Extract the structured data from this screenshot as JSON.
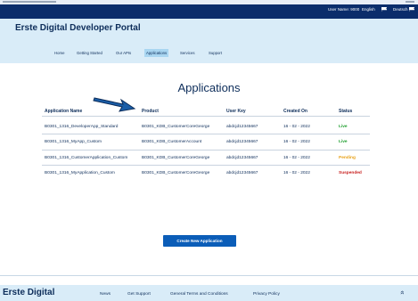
{
  "topbar": {
    "user_label": "User Name: 9000",
    "language_en": "English",
    "language_de": "Deutsch",
    "colors": {
      "background": "#0b2d6b"
    }
  },
  "header": {
    "brand": "Erste Digital Developer Portal",
    "nav": [
      {
        "label": "Home"
      },
      {
        "label": "Getting Started"
      },
      {
        "label": "Our APIs"
      },
      {
        "label": "Applications",
        "active": true
      },
      {
        "label": "Services"
      },
      {
        "label": "Support"
      }
    ]
  },
  "main": {
    "title": "Applications",
    "table": {
      "columns": [
        "Application Name",
        "Product",
        "User Key",
        "Created On",
        "Status"
      ],
      "rows": [
        [
          "B0301_1316_DeveloperApp_Standard",
          "B0301_KDB_CustomerCoreGeorge",
          "abdcjd12345667",
          "16 - 02 - 2022",
          "Live"
        ],
        [
          "B0301_1316_MyApp_Custom",
          "B0301_KDB_CustomerAccount",
          "abdcjd12345667",
          "16 - 02 - 2022",
          "Live"
        ],
        [
          "B0301_1316_CustomerApplication_Custom",
          "B0301_KDB_CustomerCoreGeorge",
          "abdcjd12345667",
          "16 - 02 - 2022",
          "Pending"
        ],
        [
          "B0301_1316_MyApplication_Custom",
          "B0301_KDB_CustomerCoreGeorge",
          "abdcjd12345667",
          "16 - 02 - 2022",
          "Suspended"
        ]
      ]
    },
    "create_button": "Create New Application",
    "status_colors": {
      "Live": "#1f9e2f",
      "Pending": "#e8a21a",
      "Suspended": "#c8201f"
    }
  },
  "footer": {
    "brand": "Erste Digital",
    "links": [
      "News",
      "Get Support",
      "General Terms and Conditions",
      "Privacy Policy"
    ]
  }
}
